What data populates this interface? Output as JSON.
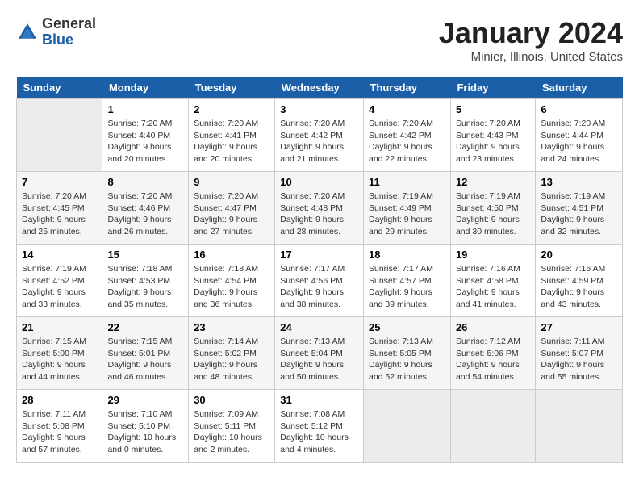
{
  "header": {
    "logo": {
      "general": "General",
      "blue": "Blue"
    },
    "title": "January 2024",
    "subtitle": "Minier, Illinois, United States"
  },
  "columns": [
    "Sunday",
    "Monday",
    "Tuesday",
    "Wednesday",
    "Thursday",
    "Friday",
    "Saturday"
  ],
  "weeks": [
    {
      "days": [
        {
          "num": "",
          "empty": true
        },
        {
          "num": "1",
          "sunrise": "7:20 AM",
          "sunset": "4:40 PM",
          "daylight": "9 hours and 20 minutes."
        },
        {
          "num": "2",
          "sunrise": "7:20 AM",
          "sunset": "4:41 PM",
          "daylight": "9 hours and 20 minutes."
        },
        {
          "num": "3",
          "sunrise": "7:20 AM",
          "sunset": "4:42 PM",
          "daylight": "9 hours and 21 minutes."
        },
        {
          "num": "4",
          "sunrise": "7:20 AM",
          "sunset": "4:42 PM",
          "daylight": "9 hours and 22 minutes."
        },
        {
          "num": "5",
          "sunrise": "7:20 AM",
          "sunset": "4:43 PM",
          "daylight": "9 hours and 23 minutes."
        },
        {
          "num": "6",
          "sunrise": "7:20 AM",
          "sunset": "4:44 PM",
          "daylight": "9 hours and 24 minutes."
        }
      ]
    },
    {
      "days": [
        {
          "num": "7",
          "sunrise": "7:20 AM",
          "sunset": "4:45 PM",
          "daylight": "9 hours and 25 minutes."
        },
        {
          "num": "8",
          "sunrise": "7:20 AM",
          "sunset": "4:46 PM",
          "daylight": "9 hours and 26 minutes."
        },
        {
          "num": "9",
          "sunrise": "7:20 AM",
          "sunset": "4:47 PM",
          "daylight": "9 hours and 27 minutes."
        },
        {
          "num": "10",
          "sunrise": "7:20 AM",
          "sunset": "4:48 PM",
          "daylight": "9 hours and 28 minutes."
        },
        {
          "num": "11",
          "sunrise": "7:19 AM",
          "sunset": "4:49 PM",
          "daylight": "9 hours and 29 minutes."
        },
        {
          "num": "12",
          "sunrise": "7:19 AM",
          "sunset": "4:50 PM",
          "daylight": "9 hours and 30 minutes."
        },
        {
          "num": "13",
          "sunrise": "7:19 AM",
          "sunset": "4:51 PM",
          "daylight": "9 hours and 32 minutes."
        }
      ]
    },
    {
      "days": [
        {
          "num": "14",
          "sunrise": "7:19 AM",
          "sunset": "4:52 PM",
          "daylight": "9 hours and 33 minutes."
        },
        {
          "num": "15",
          "sunrise": "7:18 AM",
          "sunset": "4:53 PM",
          "daylight": "9 hours and 35 minutes."
        },
        {
          "num": "16",
          "sunrise": "7:18 AM",
          "sunset": "4:54 PM",
          "daylight": "9 hours and 36 minutes."
        },
        {
          "num": "17",
          "sunrise": "7:17 AM",
          "sunset": "4:56 PM",
          "daylight": "9 hours and 38 minutes."
        },
        {
          "num": "18",
          "sunrise": "7:17 AM",
          "sunset": "4:57 PM",
          "daylight": "9 hours and 39 minutes."
        },
        {
          "num": "19",
          "sunrise": "7:16 AM",
          "sunset": "4:58 PM",
          "daylight": "9 hours and 41 minutes."
        },
        {
          "num": "20",
          "sunrise": "7:16 AM",
          "sunset": "4:59 PM",
          "daylight": "9 hours and 43 minutes."
        }
      ]
    },
    {
      "days": [
        {
          "num": "21",
          "sunrise": "7:15 AM",
          "sunset": "5:00 PM",
          "daylight": "9 hours and 44 minutes."
        },
        {
          "num": "22",
          "sunrise": "7:15 AM",
          "sunset": "5:01 PM",
          "daylight": "9 hours and 46 minutes."
        },
        {
          "num": "23",
          "sunrise": "7:14 AM",
          "sunset": "5:02 PM",
          "daylight": "9 hours and 48 minutes."
        },
        {
          "num": "24",
          "sunrise": "7:13 AM",
          "sunset": "5:04 PM",
          "daylight": "9 hours and 50 minutes."
        },
        {
          "num": "25",
          "sunrise": "7:13 AM",
          "sunset": "5:05 PM",
          "daylight": "9 hours and 52 minutes."
        },
        {
          "num": "26",
          "sunrise": "7:12 AM",
          "sunset": "5:06 PM",
          "daylight": "9 hours and 54 minutes."
        },
        {
          "num": "27",
          "sunrise": "7:11 AM",
          "sunset": "5:07 PM",
          "daylight": "9 hours and 55 minutes."
        }
      ]
    },
    {
      "days": [
        {
          "num": "28",
          "sunrise": "7:11 AM",
          "sunset": "5:08 PM",
          "daylight": "9 hours and 57 minutes."
        },
        {
          "num": "29",
          "sunrise": "7:10 AM",
          "sunset": "5:10 PM",
          "daylight": "10 hours and 0 minutes."
        },
        {
          "num": "30",
          "sunrise": "7:09 AM",
          "sunset": "5:11 PM",
          "daylight": "10 hours and 2 minutes."
        },
        {
          "num": "31",
          "sunrise": "7:08 AM",
          "sunset": "5:12 PM",
          "daylight": "10 hours and 4 minutes."
        },
        {
          "num": "",
          "empty": true
        },
        {
          "num": "",
          "empty": true
        },
        {
          "num": "",
          "empty": true
        }
      ]
    }
  ],
  "labels": {
    "sunrise": "Sunrise:",
    "sunset": "Sunset:",
    "daylight": "Daylight:"
  }
}
